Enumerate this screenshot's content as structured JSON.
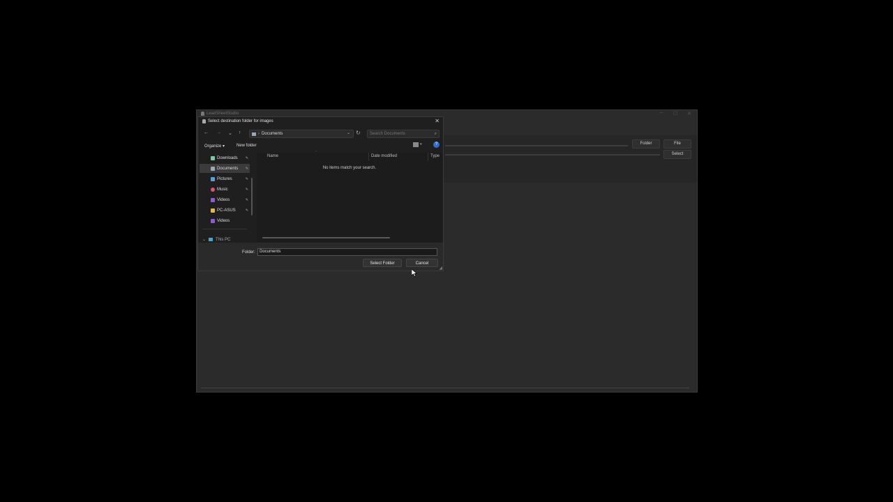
{
  "app": {
    "title": "LeadSheetStudio",
    "controls": [
      "─",
      "☐",
      "✕"
    ],
    "folder_button": "Folder",
    "file_button": "File",
    "select_button": "Select"
  },
  "dialog": {
    "title": "Select destination folder for images",
    "close": "✕",
    "nav": {
      "back": "←",
      "forward": "→",
      "recent": "⌄",
      "up": "↑"
    },
    "address": {
      "separator": "›",
      "path": "Documents",
      "dropdown": "⌄"
    },
    "refresh": "↻",
    "search_placeholder": "Search Documents",
    "toolbar": {
      "organize": "Organize ▾",
      "new_folder": "New folder",
      "help": "?",
      "view_chevron": "▾"
    },
    "nav_pane": [
      {
        "label": "Downloads",
        "pin": "📌",
        "icon": "download-icon",
        "color": "#7fc6a4"
      },
      {
        "label": "Documents",
        "pin": "📌",
        "icon": "document-icon",
        "color": "#9aa7b8",
        "selected": true
      },
      {
        "label": "Pictures",
        "pin": "📌",
        "icon": "pictures-icon",
        "color": "#5aa0d8"
      },
      {
        "label": "Music",
        "pin": "📌",
        "icon": "music-icon",
        "color": "#d8566a"
      },
      {
        "label": "Videos",
        "pin": "📌",
        "icon": "videos-icon",
        "color": "#8d5ad0"
      },
      {
        "label": "PC-ASUS",
        "pin": "📌",
        "icon": "folder-icon",
        "color": "#e2b84a"
      },
      {
        "label": "Videos",
        "pin": "",
        "icon": "videos-icon",
        "color": "#8d5ad0"
      }
    ],
    "this_pc": {
      "chevron": "⌄",
      "label": "This PC"
    },
    "columns": {
      "name": "Name",
      "date_modified": "Date modified",
      "type": "Type"
    },
    "empty_message": "No items match your search.",
    "folder_label": "Folder:",
    "folder_value": "Documents",
    "select_folder_button": "Select Folder",
    "cancel_button": "Cancel"
  }
}
